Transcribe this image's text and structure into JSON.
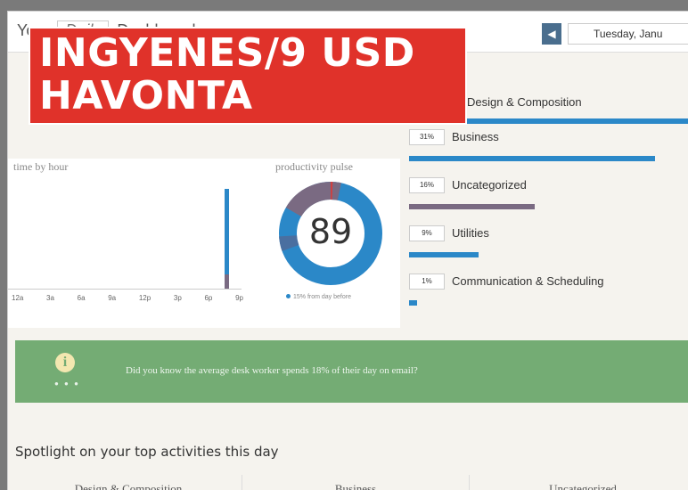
{
  "header": {
    "brand_prefix": "Your",
    "brand_daily": "Daily",
    "brand_suffix": "Dashboard",
    "prev_arrow": "◀",
    "date": "Tuesday, Janu"
  },
  "promo": {
    "line1": "INGYENES/9 USD",
    "line2": "HAVONTA"
  },
  "time_chart": {
    "title": "time by hour",
    "ticks": [
      "12a",
      "3a",
      "6a",
      "9a",
      "12p",
      "3p",
      "6p",
      "9p"
    ]
  },
  "pulse": {
    "title": "productivity pulse",
    "score": "89",
    "legend": "15% from day before"
  },
  "categories": {
    "top_label": "Design & Composition",
    "items": [
      {
        "pct": "31%",
        "name": "Business",
        "color": "#2b88c8",
        "value": 0.92
      },
      {
        "pct": "16%",
        "name": "Uncategorized",
        "color": "#7a6a82",
        "value": 0.47
      },
      {
        "pct": "9%",
        "name": "Utilities",
        "color": "#2b88c8",
        "value": 0.26
      },
      {
        "pct": "1%",
        "name": "Communication & Scheduling",
        "color": "#2b88c8",
        "value": 0.03
      }
    ]
  },
  "tip": {
    "icon": "info-icon",
    "text": "Did you know the average desk worker spends 18% of their day on email?",
    "dots": "● ● ●"
  },
  "spotlight": {
    "title": "Spotlight on your top activities this day",
    "columns": [
      "Design & Composition",
      "Business",
      "Uncategorized"
    ]
  },
  "colors": {
    "accent": "#2b88c8",
    "secondary": "#7a6a82",
    "tip_bg": "#74ac74",
    "promo_bg": "#e0322a"
  }
}
